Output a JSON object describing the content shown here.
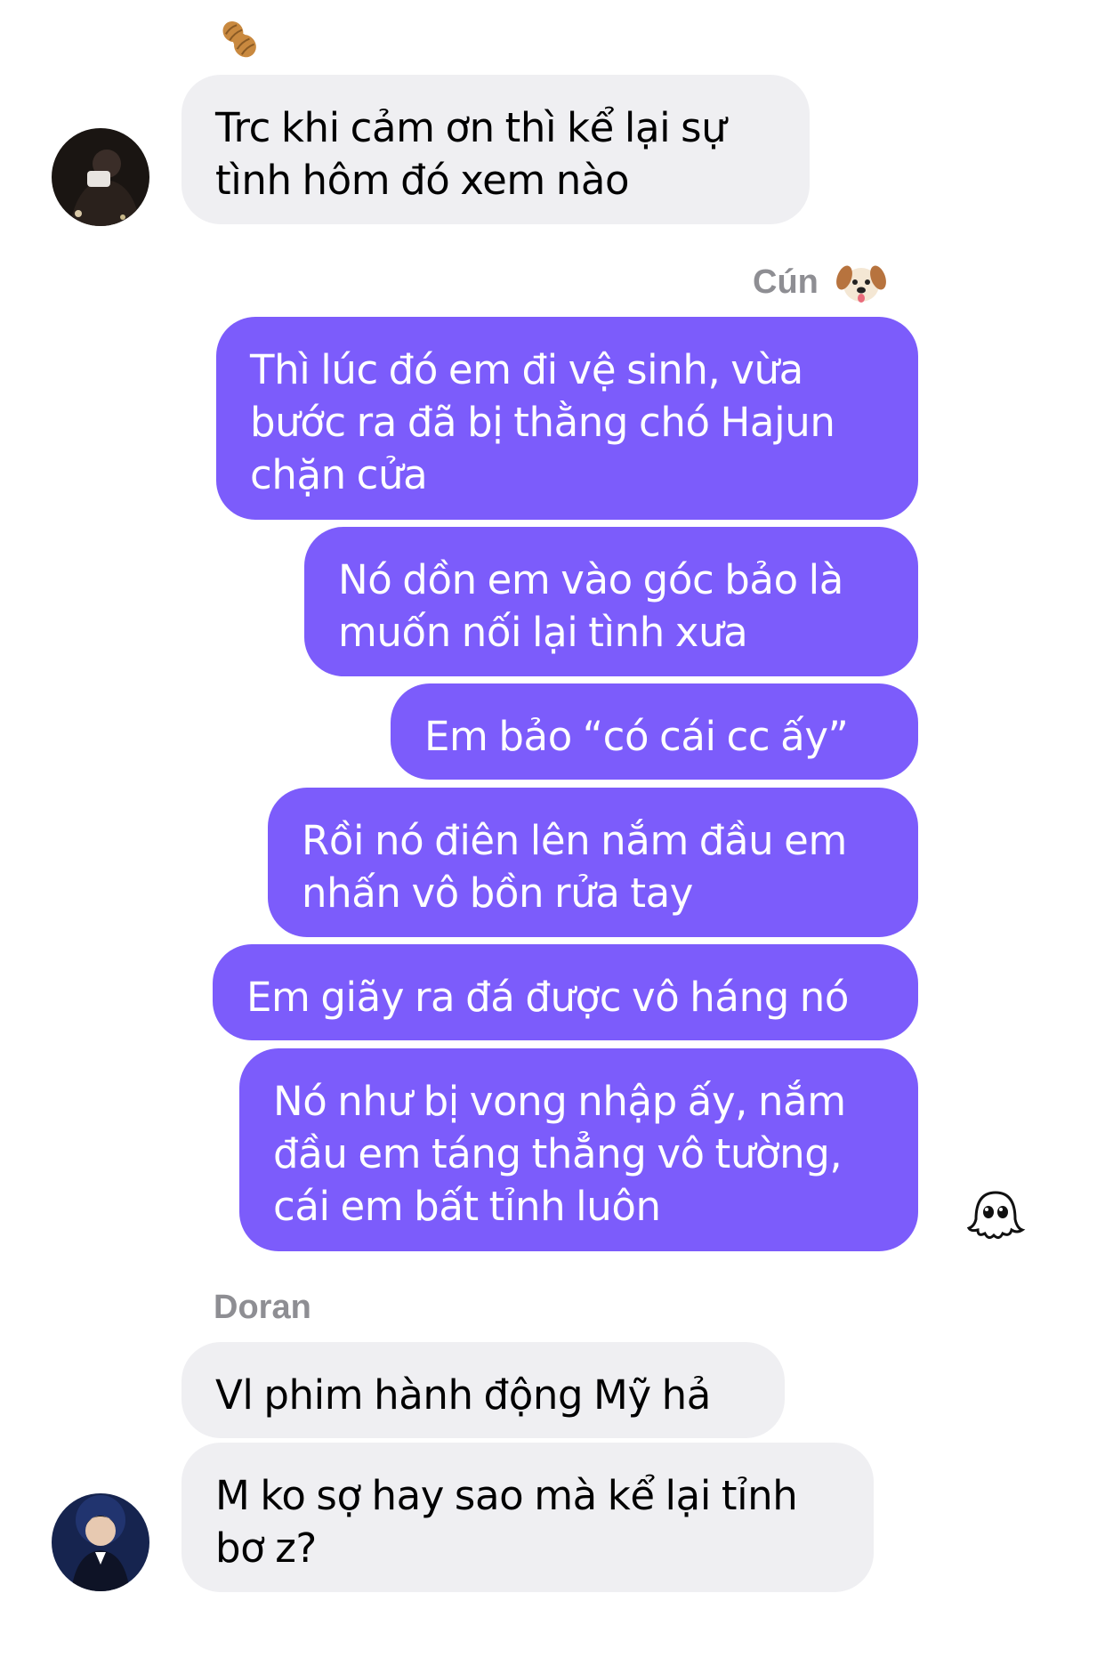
{
  "conversation": {
    "peanut_reaction": {
      "icon": "peanut-icon"
    },
    "msg_1": {
      "sender": "",
      "text": "Trc khi cảm ơn thì kể lại sự\ntình hôm đó xem nào"
    },
    "outgoing": {
      "sender_label": "Cún",
      "sender_icon": "dog-face-icon",
      "messages": [
        "Thì lúc đó em đi vệ sinh, vừa\nbước ra đã bị thằng chó Hajun\nchặn cửa",
        "Nó dồn em vào góc bảo là\nmuốn nối lại tình xưa",
        "Em bảo “có cái cc ấy”",
        "Rồi nó điên lên nắm đầu em\nnhấn vô bồn rửa tay",
        "Em giãy ra đá được vô háng nó",
        "Nó như bị vong nhập ấy, nắm\nđầu em táng thẳng vô tường,\ncái em bất tỉnh luôn"
      ],
      "read_receipt_icon": "ghost-sticker-icon"
    },
    "doran": {
      "sender_label": "Doran",
      "messages": [
        "Vl phim hành động Mỹ hả",
        "M ko sợ hay sao mà kể lại tỉnh\nbơ z?"
      ]
    }
  },
  "colors": {
    "outgoing_bubble": "#7c5cfb",
    "incoming_bubble": "#efeff2",
    "sender_label": "#8e8e93"
  }
}
